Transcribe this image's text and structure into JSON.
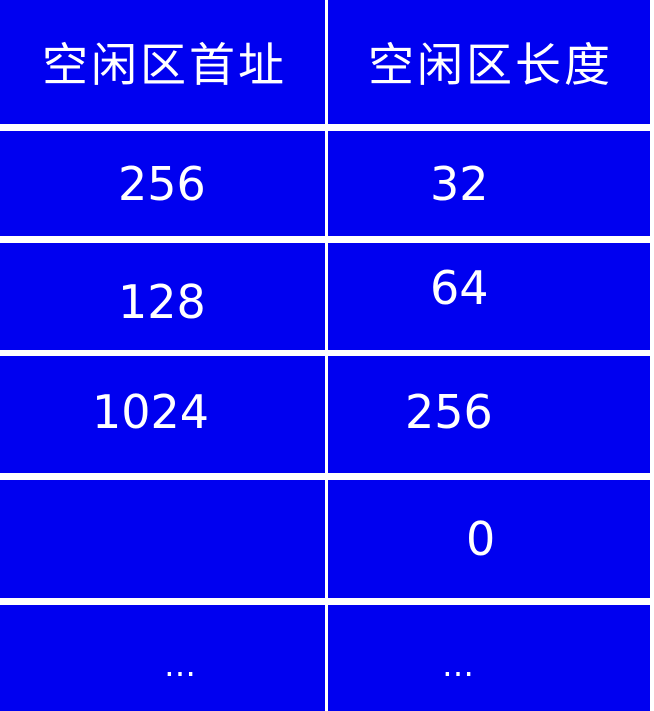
{
  "table": {
    "headers": [
      "空闲区首址",
      "空闲区长度"
    ],
    "rows": [
      [
        "256",
        "32"
      ],
      [
        "128",
        "64"
      ],
      [
        "1024",
        "256"
      ],
      [
        "",
        "0"
      ],
      [
        "…",
        "…"
      ]
    ]
  },
  "colors": {
    "cell_background": "#0000f0",
    "text": "#ffffff",
    "grid_lines": "#ffffff"
  }
}
